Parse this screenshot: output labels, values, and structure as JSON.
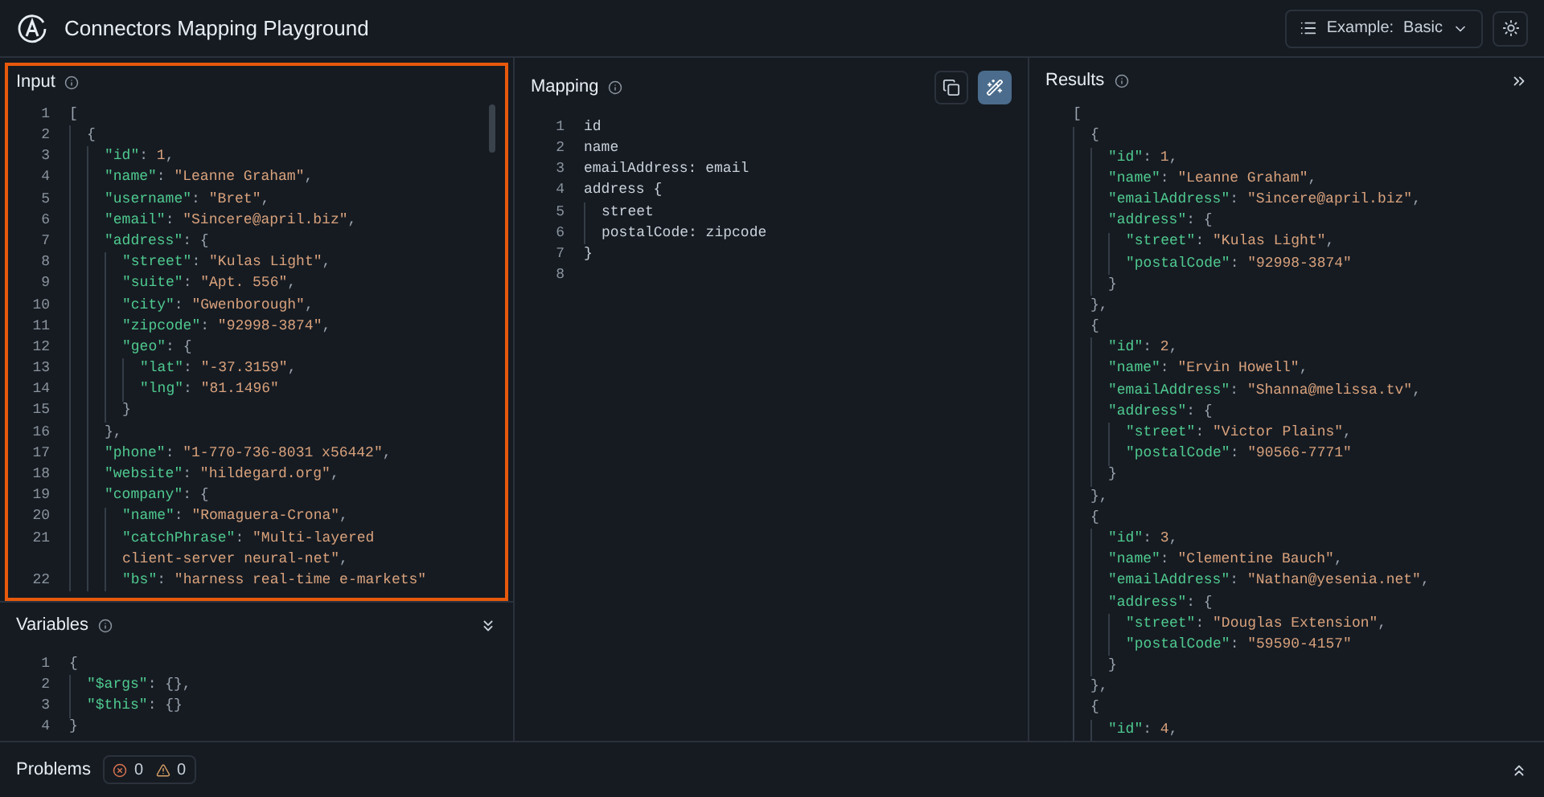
{
  "header": {
    "title": "Connectors Mapping Playground",
    "example": {
      "label": "Example:",
      "value": "Basic"
    }
  },
  "input": {
    "title": "Input",
    "focused": true,
    "lines": [
      {
        "n": "1",
        "tokens": [
          {
            "kind": "punct",
            "text": "["
          }
        ],
        "children": [
          {
            "n": "2",
            "tokens": [
              {
                "kind": "punct",
                "text": "{"
              }
            ],
            "children": [
              {
                "n": "3",
                "tokens": [
                  {
                    "kind": "key",
                    "text": "\"id\""
                  },
                  {
                    "kind": "punct",
                    "text": ": "
                  },
                  {
                    "kind": "value",
                    "text": "1"
                  },
                  {
                    "kind": "punct",
                    "text": ","
                  }
                ]
              },
              {
                "n": "4",
                "tokens": [
                  {
                    "kind": "key",
                    "text": "\"name\""
                  },
                  {
                    "kind": "punct",
                    "text": ": "
                  },
                  {
                    "kind": "value",
                    "text": "\"Leanne Graham\""
                  },
                  {
                    "kind": "punct",
                    "text": ","
                  }
                ]
              },
              {
                "n": "5",
                "tokens": [
                  {
                    "kind": "key",
                    "text": "\"username\""
                  },
                  {
                    "kind": "punct",
                    "text": ": "
                  },
                  {
                    "kind": "value",
                    "text": "\"Bret\""
                  },
                  {
                    "kind": "punct",
                    "text": ","
                  }
                ]
              },
              {
                "n": "6",
                "tokens": [
                  {
                    "kind": "key",
                    "text": "\"email\""
                  },
                  {
                    "kind": "punct",
                    "text": ": "
                  },
                  {
                    "kind": "value",
                    "text": "\"Sincere@april.biz\""
                  },
                  {
                    "kind": "punct",
                    "text": ","
                  }
                ]
              },
              {
                "n": "7",
                "tokens": [
                  {
                    "kind": "key",
                    "text": "\"address\""
                  },
                  {
                    "kind": "punct",
                    "text": ": {"
                  }
                ],
                "children": [
                  {
                    "n": "8",
                    "tokens": [
                      {
                        "kind": "key",
                        "text": "\"street\""
                      },
                      {
                        "kind": "punct",
                        "text": ": "
                      },
                      {
                        "kind": "value",
                        "text": "\"Kulas Light\""
                      },
                      {
                        "kind": "punct",
                        "text": ","
                      }
                    ]
                  },
                  {
                    "n": "9",
                    "tokens": [
                      {
                        "kind": "key",
                        "text": "\"suite\""
                      },
                      {
                        "kind": "punct",
                        "text": ": "
                      },
                      {
                        "kind": "value",
                        "text": "\"Apt. 556\""
                      },
                      {
                        "kind": "punct",
                        "text": ","
                      }
                    ]
                  },
                  {
                    "n": "10",
                    "tokens": [
                      {
                        "kind": "key",
                        "text": "\"city\""
                      },
                      {
                        "kind": "punct",
                        "text": ": "
                      },
                      {
                        "kind": "value",
                        "text": "\"Gwenborough\""
                      },
                      {
                        "kind": "punct",
                        "text": ","
                      }
                    ]
                  },
                  {
                    "n": "11",
                    "tokens": [
                      {
                        "kind": "key",
                        "text": "\"zipcode\""
                      },
                      {
                        "kind": "punct",
                        "text": ": "
                      },
                      {
                        "kind": "value",
                        "text": "\"92998-3874\""
                      },
                      {
                        "kind": "punct",
                        "text": ","
                      }
                    ]
                  },
                  {
                    "n": "12",
                    "tokens": [
                      {
                        "kind": "key",
                        "text": "\"geo\""
                      },
                      {
                        "kind": "punct",
                        "text": ": {"
                      }
                    ],
                    "children": [
                      {
                        "n": "13",
                        "tokens": [
                          {
                            "kind": "key",
                            "text": "\"lat\""
                          },
                          {
                            "kind": "punct",
                            "text": ": "
                          },
                          {
                            "kind": "value",
                            "text": "\"-37.3159\""
                          },
                          {
                            "kind": "punct",
                            "text": ","
                          }
                        ]
                      },
                      {
                        "n": "14",
                        "tokens": [
                          {
                            "kind": "key",
                            "text": "\"lng\""
                          },
                          {
                            "kind": "punct",
                            "text": ": "
                          },
                          {
                            "kind": "value",
                            "text": "\"81.1496\""
                          }
                        ]
                      }
                    ]
                  },
                  {
                    "n": "15",
                    "tokens": [
                      {
                        "kind": "punct",
                        "text": "}"
                      }
                    ]
                  }
                ]
              },
              {
                "n": "16",
                "tokens": [
                  {
                    "kind": "punct",
                    "text": "},"
                  }
                ]
              },
              {
                "n": "17",
                "tokens": [
                  {
                    "kind": "key",
                    "text": "\"phone\""
                  },
                  {
                    "kind": "punct",
                    "text": ": "
                  },
                  {
                    "kind": "value",
                    "text": "\"1-770-736-8031 x56442\""
                  },
                  {
                    "kind": "punct",
                    "text": ","
                  }
                ]
              },
              {
                "n": "18",
                "tokens": [
                  {
                    "kind": "key",
                    "text": "\"website\""
                  },
                  {
                    "kind": "punct",
                    "text": ": "
                  },
                  {
                    "kind": "value",
                    "text": "\"hildegard.org\""
                  },
                  {
                    "kind": "punct",
                    "text": ","
                  }
                ]
              },
              {
                "n": "19",
                "tokens": [
                  {
                    "kind": "key",
                    "text": "\"company\""
                  },
                  {
                    "kind": "punct",
                    "text": ": {"
                  }
                ],
                "children": [
                  {
                    "n": "20",
                    "tokens": [
                      {
                        "kind": "key",
                        "text": "\"name\""
                      },
                      {
                        "kind": "punct",
                        "text": ": "
                      },
                      {
                        "kind": "value",
                        "text": "\"Romaguera-Crona\""
                      },
                      {
                        "kind": "punct",
                        "text": ","
                      }
                    ]
                  },
                  {
                    "n": "21",
                    "tokens": [
                      {
                        "kind": "key",
                        "text": "\"catchPhrase\""
                      },
                      {
                        "kind": "punct",
                        "text": ": "
                      },
                      {
                        "kind": "value",
                        "text": "\"Multi-layered"
                      }
                    ],
                    "continuation": [
                      {
                        "kind": "value",
                        "text": "client-server neural-net\""
                      },
                      {
                        "kind": "punct",
                        "text": ","
                      }
                    ]
                  },
                  {
                    "n": "22",
                    "tokens": [
                      {
                        "kind": "key",
                        "text": "\"bs\""
                      },
                      {
                        "kind": "punct",
                        "text": ": "
                      },
                      {
                        "kind": "value",
                        "text": "\"harness real-time e-markets\""
                      }
                    ]
                  }
                ]
              }
            ]
          }
        ]
      }
    ]
  },
  "variables": {
    "title": "Variables",
    "lines": [
      {
        "n": "1",
        "tokens": [
          {
            "kind": "punct",
            "text": "{"
          }
        ],
        "children": [
          {
            "n": "2",
            "tokens": [
              {
                "kind": "key",
                "text": "\"$args\""
              },
              {
                "kind": "punct",
                "text": ": {},"
              }
            ]
          },
          {
            "n": "3",
            "tokens": [
              {
                "kind": "key",
                "text": "\"$this\""
              },
              {
                "kind": "punct",
                "text": ": {}"
              }
            ]
          }
        ]
      },
      {
        "n": "4",
        "tokens": [
          {
            "kind": "punct",
            "text": "}"
          }
        ]
      }
    ]
  },
  "mapping": {
    "title": "Mapping",
    "tools": [
      {
        "kind": "copy",
        "on": false
      },
      {
        "kind": "format",
        "on": true
      }
    ],
    "lines": [
      {
        "n": "1",
        "tokens": [
          {
            "kind": "plain",
            "text": "id"
          }
        ]
      },
      {
        "n": "2",
        "tokens": [
          {
            "kind": "plain",
            "text": "name"
          }
        ]
      },
      {
        "n": "3",
        "tokens": [
          {
            "kind": "plain",
            "text": "emailAddress: email"
          }
        ]
      },
      {
        "n": "4",
        "tokens": [
          {
            "kind": "plain",
            "text": "address {"
          }
        ],
        "children": [
          {
            "n": "5",
            "tokens": [
              {
                "kind": "plain",
                "text": "street"
              }
            ]
          },
          {
            "n": "6",
            "tokens": [
              {
                "kind": "plain",
                "text": "postalCode: zipcode"
              }
            ]
          }
        ]
      },
      {
        "n": "7",
        "tokens": [
          {
            "kind": "plain",
            "text": "}"
          }
        ]
      },
      {
        "n": "8"
      }
    ]
  },
  "results": {
    "title": "Results",
    "lines": [
      {
        "tokens": [
          {
            "kind": "punct",
            "text": "["
          }
        ],
        "children": [
          {
            "tokens": [
              {
                "kind": "punct",
                "text": "{"
              }
            ],
            "children": [
              {
                "tokens": [
                  {
                    "kind": "key",
                    "text": "\"id\""
                  },
                  {
                    "kind": "punct",
                    "text": ": "
                  },
                  {
                    "kind": "value",
                    "text": "1"
                  },
                  {
                    "kind": "punct",
                    "text": ","
                  }
                ]
              },
              {
                "tokens": [
                  {
                    "kind": "key",
                    "text": "\"name\""
                  },
                  {
                    "kind": "punct",
                    "text": ": "
                  },
                  {
                    "kind": "value",
                    "text": "\"Leanne Graham\""
                  },
                  {
                    "kind": "punct",
                    "text": ","
                  }
                ]
              },
              {
                "tokens": [
                  {
                    "kind": "key",
                    "text": "\"emailAddress\""
                  },
                  {
                    "kind": "punct",
                    "text": ": "
                  },
                  {
                    "kind": "value",
                    "text": "\"Sincere@april.biz\""
                  },
                  {
                    "kind": "punct",
                    "text": ","
                  }
                ]
              },
              {
                "tokens": [
                  {
                    "kind": "key",
                    "text": "\"address\""
                  },
                  {
                    "kind": "punct",
                    "text": ": {"
                  }
                ],
                "children": [
                  {
                    "tokens": [
                      {
                        "kind": "key",
                        "text": "\"street\""
                      },
                      {
                        "kind": "punct",
                        "text": ": "
                      },
                      {
                        "kind": "value",
                        "text": "\"Kulas Light\""
                      },
                      {
                        "kind": "punct",
                        "text": ","
                      }
                    ]
                  },
                  {
                    "tokens": [
                      {
                        "kind": "key",
                        "text": "\"postalCode\""
                      },
                      {
                        "kind": "punct",
                        "text": ": "
                      },
                      {
                        "kind": "value",
                        "text": "\"92998-3874\""
                      }
                    ]
                  }
                ]
              },
              {
                "tokens": [
                  {
                    "kind": "punct",
                    "text": "}"
                  }
                ]
              }
            ]
          },
          {
            "tokens": [
              {
                "kind": "punct",
                "text": "},"
              }
            ]
          },
          {
            "tokens": [
              {
                "kind": "punct",
                "text": "{"
              }
            ],
            "children": [
              {
                "tokens": [
                  {
                    "kind": "key",
                    "text": "\"id\""
                  },
                  {
                    "kind": "punct",
                    "text": ": "
                  },
                  {
                    "kind": "value",
                    "text": "2"
                  },
                  {
                    "kind": "punct",
                    "text": ","
                  }
                ]
              },
              {
                "tokens": [
                  {
                    "kind": "key",
                    "text": "\"name\""
                  },
                  {
                    "kind": "punct",
                    "text": ": "
                  },
                  {
                    "kind": "value",
                    "text": "\"Ervin Howell\""
                  },
                  {
                    "kind": "punct",
                    "text": ","
                  }
                ]
              },
              {
                "tokens": [
                  {
                    "kind": "key",
                    "text": "\"emailAddress\""
                  },
                  {
                    "kind": "punct",
                    "text": ": "
                  },
                  {
                    "kind": "value",
                    "text": "\"Shanna@melissa.tv\""
                  },
                  {
                    "kind": "punct",
                    "text": ","
                  }
                ]
              },
              {
                "tokens": [
                  {
                    "kind": "key",
                    "text": "\"address\""
                  },
                  {
                    "kind": "punct",
                    "text": ": {"
                  }
                ],
                "children": [
                  {
                    "tokens": [
                      {
                        "kind": "key",
                        "text": "\"street\""
                      },
                      {
                        "kind": "punct",
                        "text": ": "
                      },
                      {
                        "kind": "value",
                        "text": "\"Victor Plains\""
                      },
                      {
                        "kind": "punct",
                        "text": ","
                      }
                    ]
                  },
                  {
                    "tokens": [
                      {
                        "kind": "key",
                        "text": "\"postalCode\""
                      },
                      {
                        "kind": "punct",
                        "text": ": "
                      },
                      {
                        "kind": "value",
                        "text": "\"90566-7771\""
                      }
                    ]
                  }
                ]
              },
              {
                "tokens": [
                  {
                    "kind": "punct",
                    "text": "}"
                  }
                ]
              }
            ]
          },
          {
            "tokens": [
              {
                "kind": "punct",
                "text": "},"
              }
            ]
          },
          {
            "tokens": [
              {
                "kind": "punct",
                "text": "{"
              }
            ],
            "children": [
              {
                "tokens": [
                  {
                    "kind": "key",
                    "text": "\"id\""
                  },
                  {
                    "kind": "punct",
                    "text": ": "
                  },
                  {
                    "kind": "value",
                    "text": "3"
                  },
                  {
                    "kind": "punct",
                    "text": ","
                  }
                ]
              },
              {
                "tokens": [
                  {
                    "kind": "key",
                    "text": "\"name\""
                  },
                  {
                    "kind": "punct",
                    "text": ": "
                  },
                  {
                    "kind": "value",
                    "text": "\"Clementine Bauch\""
                  },
                  {
                    "kind": "punct",
                    "text": ","
                  }
                ]
              },
              {
                "tokens": [
                  {
                    "kind": "key",
                    "text": "\"emailAddress\""
                  },
                  {
                    "kind": "punct",
                    "text": ": "
                  },
                  {
                    "kind": "value",
                    "text": "\"Nathan@yesenia.net\""
                  },
                  {
                    "kind": "punct",
                    "text": ","
                  }
                ]
              },
              {
                "tokens": [
                  {
                    "kind": "key",
                    "text": "\"address\""
                  },
                  {
                    "kind": "punct",
                    "text": ": {"
                  }
                ],
                "children": [
                  {
                    "tokens": [
                      {
                        "kind": "key",
                        "text": "\"street\""
                      },
                      {
                        "kind": "punct",
                        "text": ": "
                      },
                      {
                        "kind": "value",
                        "text": "\"Douglas Extension\""
                      },
                      {
                        "kind": "punct",
                        "text": ","
                      }
                    ]
                  },
                  {
                    "tokens": [
                      {
                        "kind": "key",
                        "text": "\"postalCode\""
                      },
                      {
                        "kind": "punct",
                        "text": ": "
                      },
                      {
                        "kind": "value",
                        "text": "\"59590-4157\""
                      }
                    ]
                  }
                ]
              },
              {
                "tokens": [
                  {
                    "kind": "punct",
                    "text": "}"
                  }
                ]
              }
            ]
          },
          {
            "tokens": [
              {
                "kind": "punct",
                "text": "},"
              }
            ]
          },
          {
            "tokens": [
              {
                "kind": "punct",
                "text": "{"
              }
            ],
            "children": [
              {
                "tokens": [
                  {
                    "kind": "key",
                    "text": "\"id\""
                  },
                  {
                    "kind": "punct",
                    "text": ": "
                  },
                  {
                    "kind": "value",
                    "text": "4"
                  },
                  {
                    "kind": "punct",
                    "text": ","
                  }
                ]
              }
            ]
          }
        ]
      }
    ]
  },
  "problems": {
    "title": "Problems",
    "errors": "0",
    "warnings": "0"
  }
}
